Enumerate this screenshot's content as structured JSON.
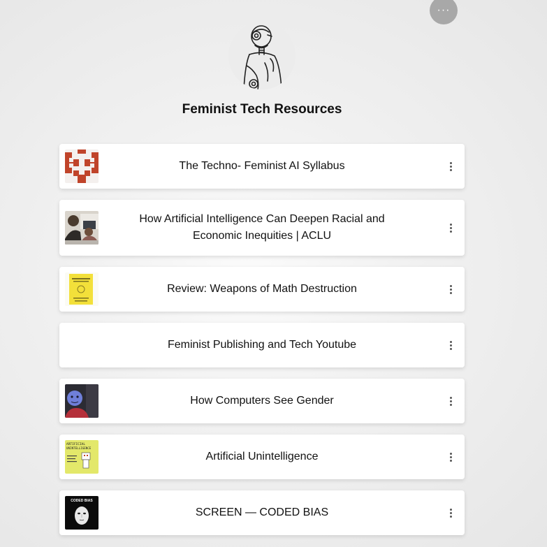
{
  "profile": {
    "title": "Feminist Tech Resources",
    "more_label": "···",
    "avatar_icon": "robot-avatar-icon"
  },
  "links": [
    {
      "label": "The Techno- Feminist AI Syllabus",
      "thumb": "gear-pattern-thumbnail"
    },
    {
      "label": "How Artificial Intelligence Can Deepen Racial and Economic Inequities | ACLU",
      "thumb": "people-at-computer-thumbnail"
    },
    {
      "label": "Review: Weapons of Math Destruction",
      "thumb": "yellow-book-cover-thumbnail"
    },
    {
      "label": "Feminist Publishing and Tech Youtube",
      "thumb": ""
    },
    {
      "label": "How Computers See Gender",
      "thumb": "face-scan-thumbnail"
    },
    {
      "label": "Artificial Unintelligence",
      "thumb": "book-cover-thumbnail"
    },
    {
      "label": "SCREEN — CODED BIAS",
      "thumb": "coded-bias-poster-thumbnail"
    }
  ],
  "thumb_texts": {
    "coded_bias": "CODED BIAS",
    "artificial": "ARTIFICIAL",
    "unintelligence": "UNINTELLIGENCE"
  },
  "colors": {
    "accent_red": "#c0442a",
    "book_yellow": "#f3e03a",
    "more_button": "#a8a8a8"
  }
}
